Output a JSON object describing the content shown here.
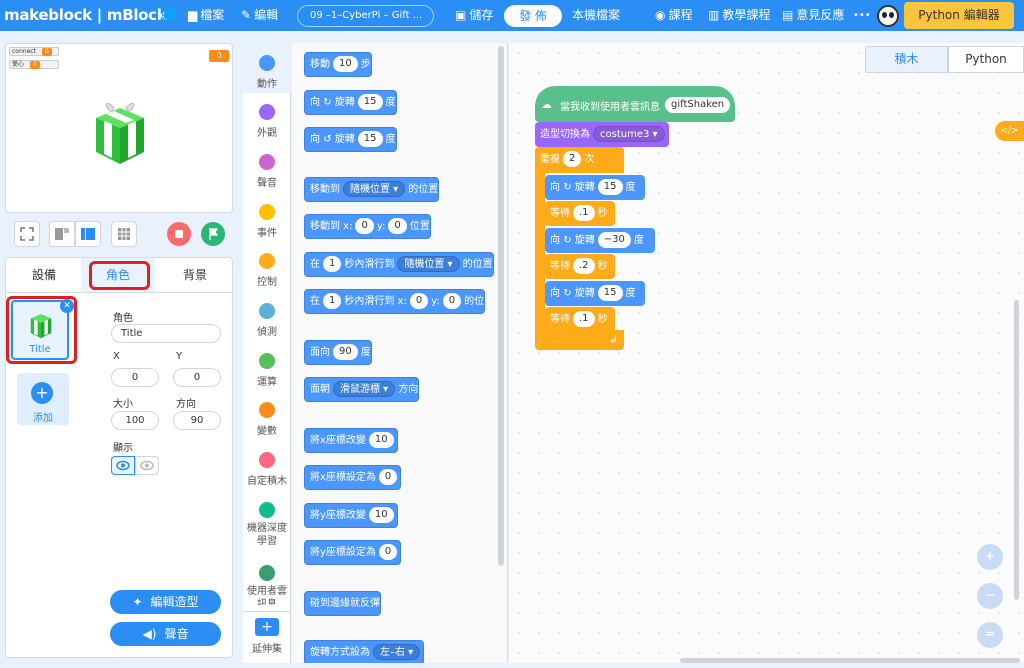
{
  "topbar": {
    "logo": "makeblock | mBlock",
    "file": "檔案",
    "edit": "編輯",
    "project_name": "09 –1–CyberPi – Gift ...",
    "save": "儲存",
    "publish": "發 佈",
    "local_file": "本機檔案",
    "courses": "課程",
    "tutorials": "教學課程",
    "feedback": "意見反應",
    "more": "•••",
    "python_editor": "Python 編輯器"
  },
  "stage": {
    "var1_name": "connect",
    "var1_value": "0",
    "var2_name": "愛心",
    "var2_value": "0",
    "counter": "0"
  },
  "sprite_panel": {
    "tabs": [
      "設備",
      "角色",
      "背景"
    ],
    "sprite_name": "Title",
    "add_label": "添加",
    "role_label": "角色",
    "name_value": "Title",
    "x_label": "X",
    "y_label": "Y",
    "x_value": "0",
    "y_value": "0",
    "size_label": "大小",
    "direction_label": "方向",
    "size_value": "100",
    "direction_value": "90",
    "show_label": "顯示",
    "edit_costume": "編輯造型",
    "sound": "聲音"
  },
  "categories": [
    "動作",
    "外觀",
    "聲音",
    "事件",
    "控制",
    "偵測",
    "運算",
    "變數",
    "自定積木",
    "機器深度學習",
    "使用者雲訊息",
    "延伸集"
  ],
  "category_colors": [
    "#4c97ff",
    "#9966ff",
    "#cf63cf",
    "#ffbf00",
    "#ffab19",
    "#5cb1d6",
    "#59c059",
    "#ff8c1a",
    "#ff6680",
    "#0fbd8c",
    "#3a9e6f"
  ],
  "palette": {
    "move": [
      "移動",
      "10",
      "步"
    ],
    "turn_right": [
      "向",
      "旋轉",
      "15",
      "度"
    ],
    "turn_left": [
      "向",
      "旋轉",
      "15",
      "度"
    ],
    "goto": [
      "移動到",
      "隨機位置 ▾",
      "的位置"
    ],
    "goto_xy": [
      "移動到 x:",
      "0",
      "y:",
      "0",
      "位置"
    ],
    "glide_to": [
      "在",
      "1",
      "秒內滑行到",
      "隨機位置 ▾",
      "的位置"
    ],
    "glide_xy": [
      "在",
      "1",
      "秒內滑行到 x:",
      "0",
      "y:",
      "0",
      "的位"
    ],
    "point_dir": [
      "面向",
      "90",
      "度"
    ],
    "point_towards": [
      "面朝",
      "滑鼠游標 ▾",
      "方向"
    ],
    "change_x": [
      "將x座標改變",
      "10"
    ],
    "set_x": [
      "將x座標設定為",
      "0"
    ],
    "change_y": [
      "將y座標改變",
      "10"
    ],
    "set_y": [
      "將y座標設定為",
      "0"
    ],
    "bounce": "碰到邊緣就反彈",
    "rotation_style": [
      "旋轉方式設為",
      "左–右 ▾"
    ]
  },
  "tabs": {
    "blocks": "積木",
    "python": "Python"
  },
  "code_toggle": "</>",
  "script": {
    "hat": [
      "當我收到使用者雲訊息",
      "giftShaken"
    ],
    "switch_costume": [
      "造型切換為",
      "costume3 ▾"
    ],
    "repeat": [
      "重複",
      "2",
      "次"
    ],
    "turn1": [
      "向",
      "旋轉",
      "15",
      "度"
    ],
    "wait1": [
      "等待",
      ".1",
      "秒"
    ],
    "turn2": [
      "向",
      "旋轉",
      "−30",
      "度"
    ],
    "wait2": [
      "等待",
      ".2",
      "秒"
    ],
    "turn3": [
      "向",
      "旋轉",
      "15",
      "度"
    ],
    "wait3": [
      "等待",
      ".1",
      "秒"
    ]
  },
  "zoom": {
    "in": "+",
    "out": "−",
    "reset": "="
  }
}
